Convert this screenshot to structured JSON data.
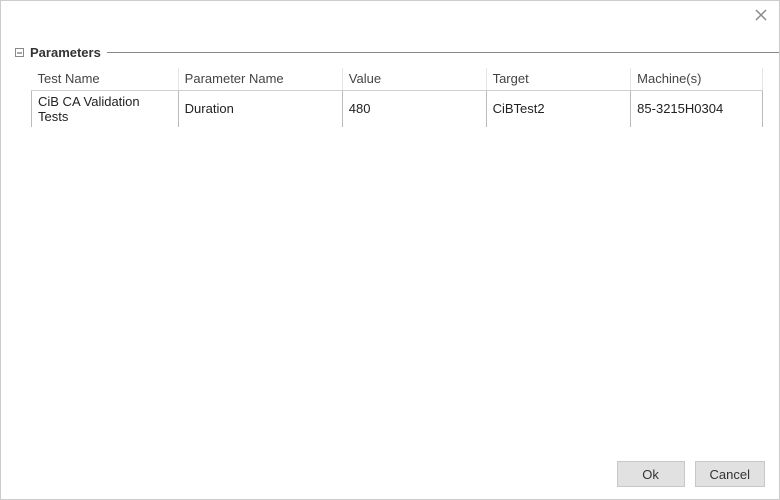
{
  "groupbox": {
    "title": "Parameters"
  },
  "table": {
    "headers": {
      "test_name": "Test Name",
      "parameter_name": "Parameter Name",
      "value": "Value",
      "target": "Target",
      "machines": "Machine(s)"
    },
    "rows": [
      {
        "test_name": "CiB CA Validation Tests",
        "parameter_name": "Duration",
        "value": "480",
        "target": "CiBTest2",
        "machines": "85-3215H0304"
      }
    ]
  },
  "buttons": {
    "ok": "Ok",
    "cancel": "Cancel"
  }
}
